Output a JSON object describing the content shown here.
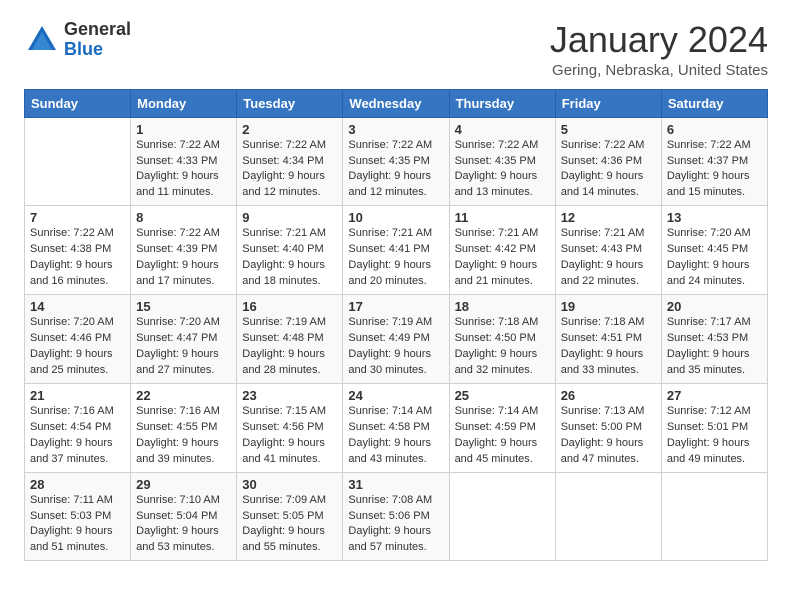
{
  "logo": {
    "general": "General",
    "blue": "Blue"
  },
  "title": "January 2024",
  "location": "Gering, Nebraska, United States",
  "weekdays": [
    "Sunday",
    "Monday",
    "Tuesday",
    "Wednesday",
    "Thursday",
    "Friday",
    "Saturday"
  ],
  "weeks": [
    [
      {
        "day": "",
        "sunrise": "",
        "sunset": "",
        "daylight": ""
      },
      {
        "day": "1",
        "sunrise": "Sunrise: 7:22 AM",
        "sunset": "Sunset: 4:33 PM",
        "daylight": "Daylight: 9 hours and 11 minutes."
      },
      {
        "day": "2",
        "sunrise": "Sunrise: 7:22 AM",
        "sunset": "Sunset: 4:34 PM",
        "daylight": "Daylight: 9 hours and 12 minutes."
      },
      {
        "day": "3",
        "sunrise": "Sunrise: 7:22 AM",
        "sunset": "Sunset: 4:35 PM",
        "daylight": "Daylight: 9 hours and 12 minutes."
      },
      {
        "day": "4",
        "sunrise": "Sunrise: 7:22 AM",
        "sunset": "Sunset: 4:35 PM",
        "daylight": "Daylight: 9 hours and 13 minutes."
      },
      {
        "day": "5",
        "sunrise": "Sunrise: 7:22 AM",
        "sunset": "Sunset: 4:36 PM",
        "daylight": "Daylight: 9 hours and 14 minutes."
      },
      {
        "day": "6",
        "sunrise": "Sunrise: 7:22 AM",
        "sunset": "Sunset: 4:37 PM",
        "daylight": "Daylight: 9 hours and 15 minutes."
      }
    ],
    [
      {
        "day": "7",
        "sunrise": "Sunrise: 7:22 AM",
        "sunset": "Sunset: 4:38 PM",
        "daylight": "Daylight: 9 hours and 16 minutes."
      },
      {
        "day": "8",
        "sunrise": "Sunrise: 7:22 AM",
        "sunset": "Sunset: 4:39 PM",
        "daylight": "Daylight: 9 hours and 17 minutes."
      },
      {
        "day": "9",
        "sunrise": "Sunrise: 7:21 AM",
        "sunset": "Sunset: 4:40 PM",
        "daylight": "Daylight: 9 hours and 18 minutes."
      },
      {
        "day": "10",
        "sunrise": "Sunrise: 7:21 AM",
        "sunset": "Sunset: 4:41 PM",
        "daylight": "Daylight: 9 hours and 20 minutes."
      },
      {
        "day": "11",
        "sunrise": "Sunrise: 7:21 AM",
        "sunset": "Sunset: 4:42 PM",
        "daylight": "Daylight: 9 hours and 21 minutes."
      },
      {
        "day": "12",
        "sunrise": "Sunrise: 7:21 AM",
        "sunset": "Sunset: 4:43 PM",
        "daylight": "Daylight: 9 hours and 22 minutes."
      },
      {
        "day": "13",
        "sunrise": "Sunrise: 7:20 AM",
        "sunset": "Sunset: 4:45 PM",
        "daylight": "Daylight: 9 hours and 24 minutes."
      }
    ],
    [
      {
        "day": "14",
        "sunrise": "Sunrise: 7:20 AM",
        "sunset": "Sunset: 4:46 PM",
        "daylight": "Daylight: 9 hours and 25 minutes."
      },
      {
        "day": "15",
        "sunrise": "Sunrise: 7:20 AM",
        "sunset": "Sunset: 4:47 PM",
        "daylight": "Daylight: 9 hours and 27 minutes."
      },
      {
        "day": "16",
        "sunrise": "Sunrise: 7:19 AM",
        "sunset": "Sunset: 4:48 PM",
        "daylight": "Daylight: 9 hours and 28 minutes."
      },
      {
        "day": "17",
        "sunrise": "Sunrise: 7:19 AM",
        "sunset": "Sunset: 4:49 PM",
        "daylight": "Daylight: 9 hours and 30 minutes."
      },
      {
        "day": "18",
        "sunrise": "Sunrise: 7:18 AM",
        "sunset": "Sunset: 4:50 PM",
        "daylight": "Daylight: 9 hours and 32 minutes."
      },
      {
        "day": "19",
        "sunrise": "Sunrise: 7:18 AM",
        "sunset": "Sunset: 4:51 PM",
        "daylight": "Daylight: 9 hours and 33 minutes."
      },
      {
        "day": "20",
        "sunrise": "Sunrise: 7:17 AM",
        "sunset": "Sunset: 4:53 PM",
        "daylight": "Daylight: 9 hours and 35 minutes."
      }
    ],
    [
      {
        "day": "21",
        "sunrise": "Sunrise: 7:16 AM",
        "sunset": "Sunset: 4:54 PM",
        "daylight": "Daylight: 9 hours and 37 minutes."
      },
      {
        "day": "22",
        "sunrise": "Sunrise: 7:16 AM",
        "sunset": "Sunset: 4:55 PM",
        "daylight": "Daylight: 9 hours and 39 minutes."
      },
      {
        "day": "23",
        "sunrise": "Sunrise: 7:15 AM",
        "sunset": "Sunset: 4:56 PM",
        "daylight": "Daylight: 9 hours and 41 minutes."
      },
      {
        "day": "24",
        "sunrise": "Sunrise: 7:14 AM",
        "sunset": "Sunset: 4:58 PM",
        "daylight": "Daylight: 9 hours and 43 minutes."
      },
      {
        "day": "25",
        "sunrise": "Sunrise: 7:14 AM",
        "sunset": "Sunset: 4:59 PM",
        "daylight": "Daylight: 9 hours and 45 minutes."
      },
      {
        "day": "26",
        "sunrise": "Sunrise: 7:13 AM",
        "sunset": "Sunset: 5:00 PM",
        "daylight": "Daylight: 9 hours and 47 minutes."
      },
      {
        "day": "27",
        "sunrise": "Sunrise: 7:12 AM",
        "sunset": "Sunset: 5:01 PM",
        "daylight": "Daylight: 9 hours and 49 minutes."
      }
    ],
    [
      {
        "day": "28",
        "sunrise": "Sunrise: 7:11 AM",
        "sunset": "Sunset: 5:03 PM",
        "daylight": "Daylight: 9 hours and 51 minutes."
      },
      {
        "day": "29",
        "sunrise": "Sunrise: 7:10 AM",
        "sunset": "Sunset: 5:04 PM",
        "daylight": "Daylight: 9 hours and 53 minutes."
      },
      {
        "day": "30",
        "sunrise": "Sunrise: 7:09 AM",
        "sunset": "Sunset: 5:05 PM",
        "daylight": "Daylight: 9 hours and 55 minutes."
      },
      {
        "day": "31",
        "sunrise": "Sunrise: 7:08 AM",
        "sunset": "Sunset: 5:06 PM",
        "daylight": "Daylight: 9 hours and 57 minutes."
      },
      {
        "day": "",
        "sunrise": "",
        "sunset": "",
        "daylight": ""
      },
      {
        "day": "",
        "sunrise": "",
        "sunset": "",
        "daylight": ""
      },
      {
        "day": "",
        "sunrise": "",
        "sunset": "",
        "daylight": ""
      }
    ]
  ]
}
